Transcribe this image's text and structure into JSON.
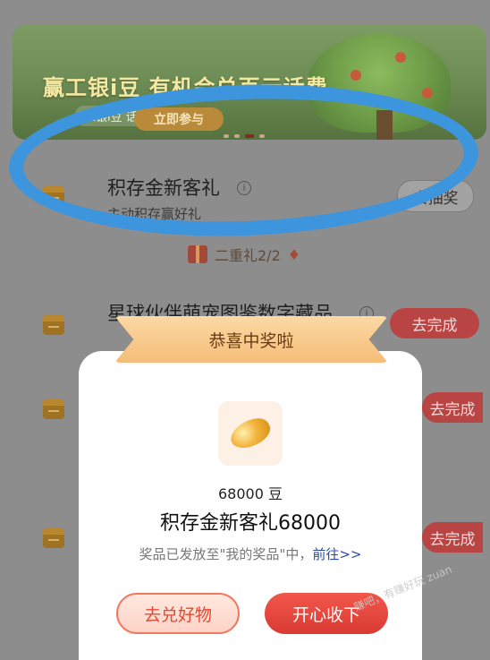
{
  "banner": {
    "title": "赢工银i豆 有机会兑百元话费",
    "subtitle": "工银i豆 话费",
    "cta": "立即参与"
  },
  "tasks": [
    {
      "title": "积存金新客礼",
      "subtitle": "主动积存赢好礼",
      "button": "去抽奖",
      "button_style": "gray"
    },
    {
      "title": "星球伙伴萌宠图鉴数字藏品",
      "subtitle": "",
      "button": "去完成",
      "button_style": "red"
    },
    {
      "title": "",
      "subtitle": "",
      "button": "去完成",
      "button_style": "red"
    },
    {
      "title": "",
      "subtitle": "",
      "button": "去完成",
      "button_style": "red"
    }
  ],
  "tier": {
    "label": "二重礼2/2"
  },
  "modal": {
    "ribbon": "恭喜中奖啦",
    "amount": "68000 豆",
    "prize_name": "积存金新客礼68000",
    "note_prefix": "奖品已发放至\"我的奖品\"中，",
    "note_link": "前往>>",
    "btn_left": "去兑好物",
    "btn_right": "开心收下"
  },
  "watermark": "赚吧，有赚好玩 zuan"
}
